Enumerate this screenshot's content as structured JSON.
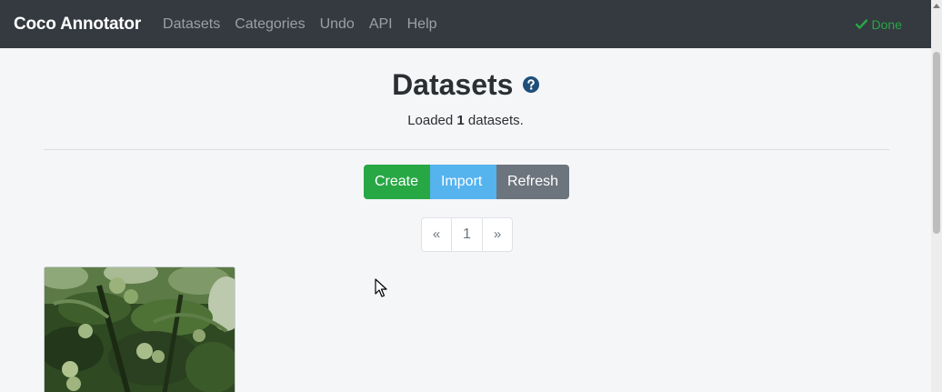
{
  "navbar": {
    "brand": "Coco Annotator",
    "items": [
      {
        "label": "Datasets"
      },
      {
        "label": "Categories"
      },
      {
        "label": "Undo"
      },
      {
        "label": "API"
      },
      {
        "label": "Help"
      }
    ],
    "status": "Done",
    "status_color": "#28a745"
  },
  "main": {
    "title": "Datasets",
    "subtitle_prefix": "Loaded ",
    "dataset_count": "1",
    "subtitle_suffix": " datasets.",
    "buttons": {
      "create": "Create",
      "import": "Import",
      "refresh": "Refresh"
    },
    "pagination": {
      "prev": "«",
      "current": "1",
      "next": "»"
    }
  },
  "icons": {
    "help": "question-circle-icon",
    "status": "check-icon"
  },
  "colors": {
    "navbar_bg": "#343a40",
    "create": "#28a745",
    "import": "#55b3ee",
    "refresh": "#6c757d",
    "help_icon": "#1f4e79"
  }
}
